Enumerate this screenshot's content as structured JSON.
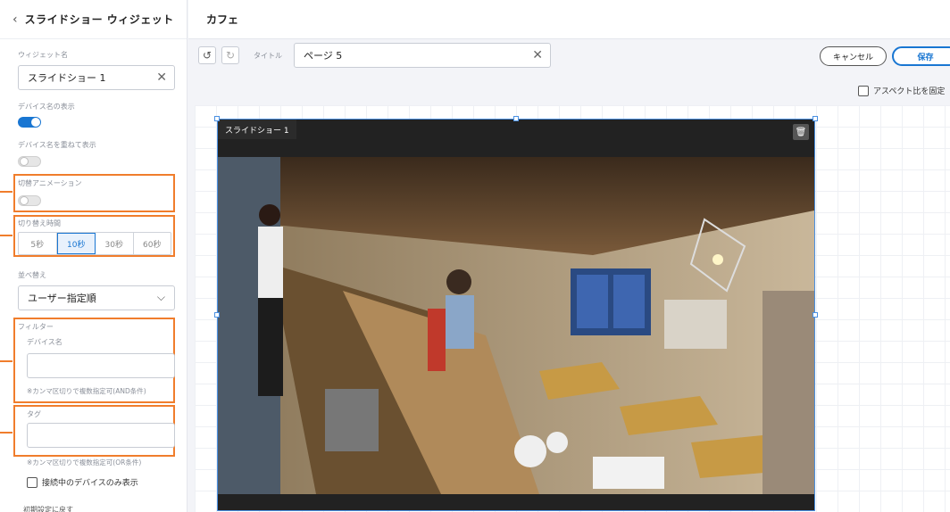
{
  "sidebar": {
    "header_title": "スライドショー ウィジェット",
    "widget_name_label": "ウィジェット名",
    "widget_name_value": "スライドショー 1",
    "show_device_name_label": "デバイス名の表示",
    "show_device_name_on": true,
    "overlay_device_name_label": "デバイス名を重ねて表示",
    "switch_animation_label": "切替アニメーション",
    "switch_time_label": "切り替え時間",
    "switch_time_options": [
      "5秒",
      "10秒",
      "30秒",
      "60秒"
    ],
    "switch_time_selected": "10秒",
    "sort_label": "並べ替え",
    "sort_value": "ユーザー指定順",
    "filter_label": "フィルター",
    "device_name_label": "デバイス名",
    "device_name_note": "※カンマ区切りで複数指定可(AND条件)",
    "tag_label": "タグ",
    "tag_note": "※カンマ区切りで複数指定可(OR条件)",
    "connected_only_label": "接続中のデバイスのみ表示",
    "reset_label": "初期設定に戻す"
  },
  "topbar": {
    "page_name": "カフェ"
  },
  "toolbar": {
    "title_label": "タイトル",
    "title_value": "ページ 5",
    "cancel_label": "キャンセル",
    "save_label": "保存",
    "aspect_label": "アスペクト比を固定"
  },
  "widget": {
    "title": "スライドショー 1"
  },
  "colors": {
    "accent": "#1976d2",
    "highlight": "#f07d2c"
  }
}
